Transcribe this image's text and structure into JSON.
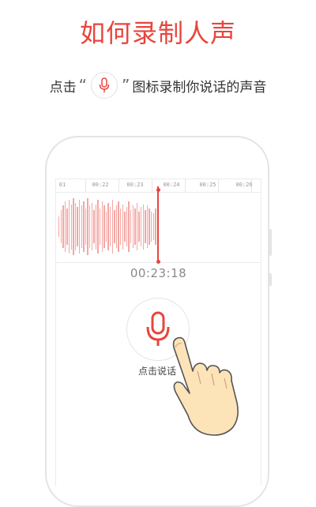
{
  "header": {
    "title": "如何录制人声",
    "subtitle_prefix": "点击",
    "quote_open": "“",
    "quote_close": "”",
    "subtitle_suffix": "图标录制你说话的声音"
  },
  "recorder": {
    "ruler_ticks": [
      "01",
      "00:22",
      "00:23",
      "00:24",
      "00:25",
      "00:26"
    ],
    "elapsed_time": "00:23:18",
    "record_button_label": "点击说话"
  },
  "icons": {
    "badge": "microphone-icon",
    "record": "microphone-icon",
    "pointer": "hand-pointer-icon"
  },
  "colors": {
    "accent": "#e8453c",
    "waveform": "#f3a7a4",
    "hand_skin": "#fde3b8"
  }
}
